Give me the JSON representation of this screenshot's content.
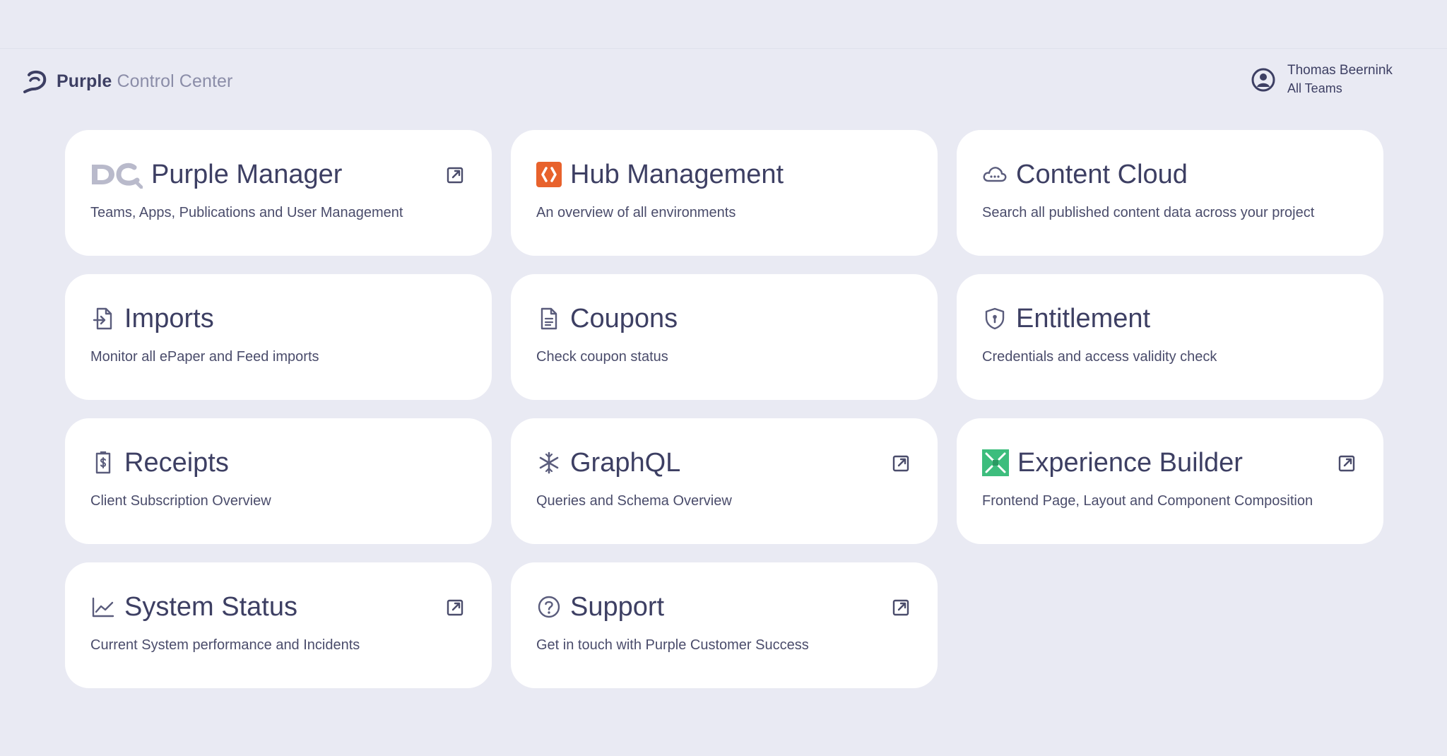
{
  "header": {
    "brand_strong": "Purple",
    "brand_light": "Control Center",
    "user_name": "Thomas Beernink",
    "user_team": "All Teams"
  },
  "cards": [
    {
      "title": "Purple Manager",
      "description": "Teams, Apps, Publications and User Management",
      "icon": "dc-logo-icon",
      "external": true
    },
    {
      "title": "Hub Management",
      "description": "An overview of all environments",
      "icon": "hub-logo-icon",
      "external": false
    },
    {
      "title": "Content Cloud",
      "description": "Search all published content data across your project",
      "icon": "cloud-icon",
      "external": false
    },
    {
      "title": "Imports",
      "description": "Monitor all ePaper and Feed imports",
      "icon": "file-import-icon",
      "external": false
    },
    {
      "title": "Coupons",
      "description": "Check coupon status",
      "icon": "document-icon",
      "external": false
    },
    {
      "title": "Entitlement",
      "description": "Credentials and access validity check",
      "icon": "shield-icon",
      "external": false
    },
    {
      "title": "Receipts",
      "description": "Client Subscription Overview",
      "icon": "receipt-icon",
      "external": false
    },
    {
      "title": "GraphQL",
      "description": "Queries and Schema Overview",
      "icon": "snowflake-icon",
      "external": true
    },
    {
      "title": "Experience Builder",
      "description": "Frontend Page, Layout and Component Composition",
      "icon": "experience-builder-logo-icon",
      "external": true
    },
    {
      "title": "System Status",
      "description": "Current System performance and Incidents",
      "icon": "chart-line-icon",
      "external": true
    },
    {
      "title": "Support",
      "description": "Get in touch with Purple Customer Success",
      "icon": "help-circle-icon",
      "external": true
    }
  ],
  "colors": {
    "background": "#e9eaf3",
    "card": "#ffffff",
    "text": "#3d3f63",
    "hub_orange": "#e8622c",
    "experience_green": "#3dbd7d"
  }
}
